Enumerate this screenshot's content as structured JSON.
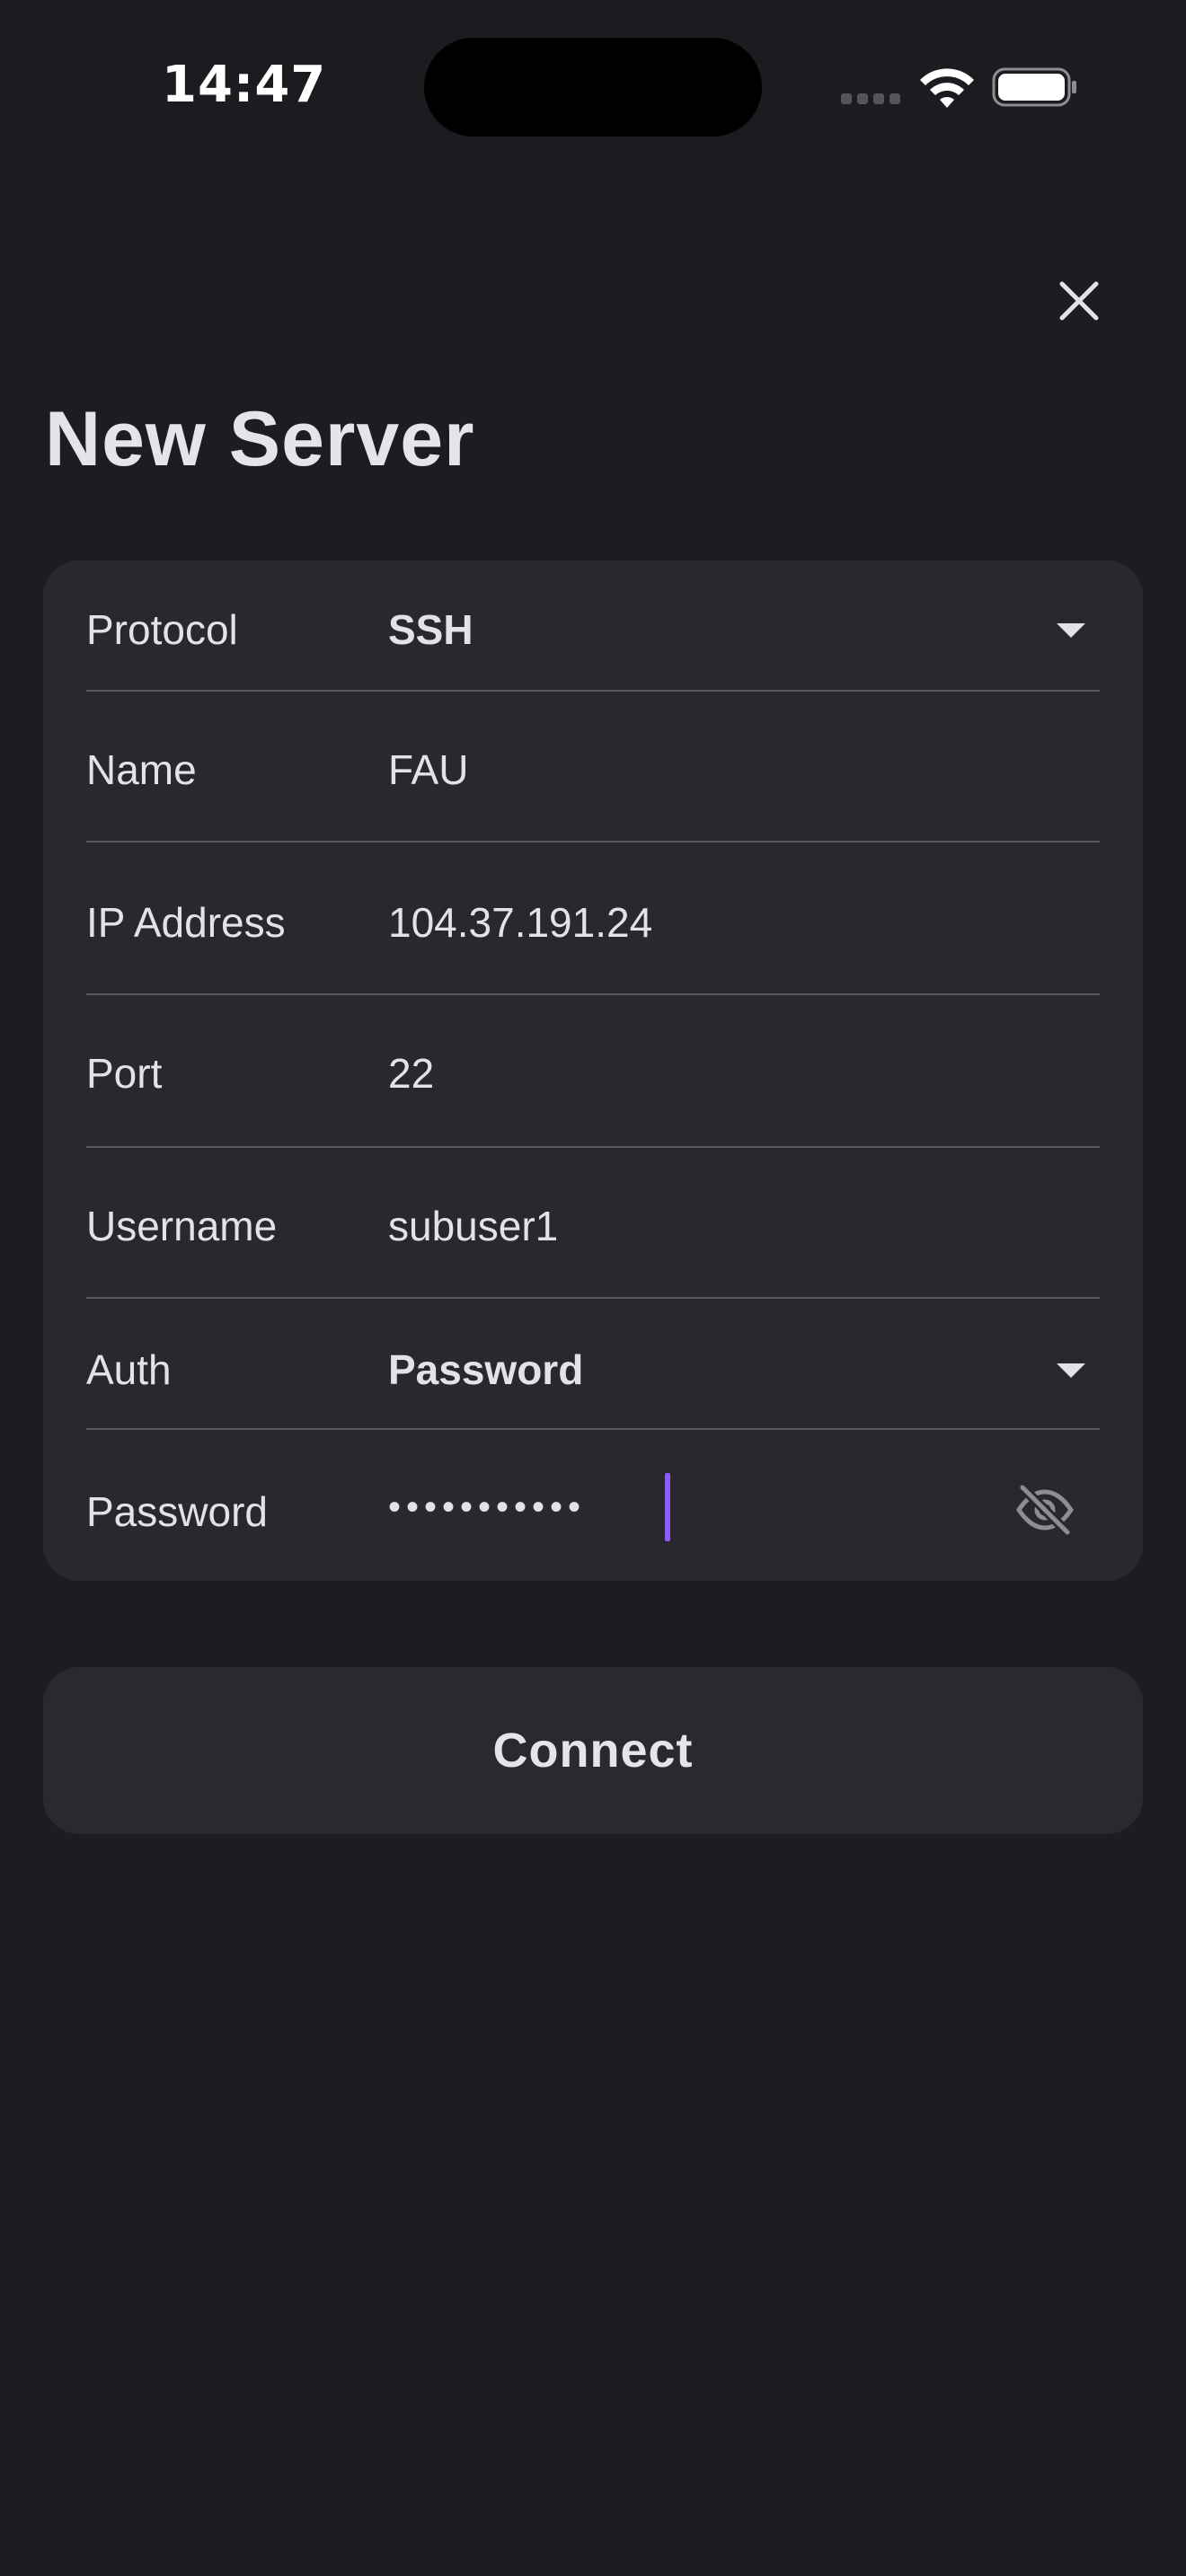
{
  "status_bar": {
    "time": "14:47"
  },
  "sheet": {
    "title": "New Server"
  },
  "form": {
    "protocol": {
      "label": "Protocol",
      "value": "SSH"
    },
    "name": {
      "label": "Name",
      "value": "FAU"
    },
    "ip_address": {
      "label": "IP Address",
      "value": "104.37.191.24"
    },
    "port": {
      "label": "Port",
      "value": "22"
    },
    "username": {
      "label": "Username",
      "value": "subuser1"
    },
    "auth": {
      "label": "Auth",
      "value": "Password"
    },
    "password": {
      "label": "Password",
      "masked_value": "•••••••••••"
    }
  },
  "actions": {
    "connect_label": "Connect"
  },
  "icons": {
    "close": "close-icon",
    "dropdown": "chevron-down-icon",
    "visibility": "eye-off-icon"
  },
  "colors": {
    "background": "#1c1b20",
    "card": "#29282e",
    "text": "#e4e2e8",
    "cursor_accent": "#8b5cf6",
    "divider": "#57565c"
  }
}
